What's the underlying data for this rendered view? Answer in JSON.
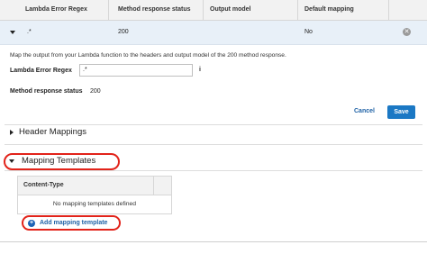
{
  "table_header": {
    "columns": [
      "Lambda Error Regex",
      "Method response status",
      "Output model",
      "Default mapping"
    ]
  },
  "row": {
    "regex": ".*",
    "status": "200",
    "output_model": "",
    "default_mapping": "No",
    "remove_glyph": "✕"
  },
  "details": {
    "description": "Map the output from your Lambda function to the headers and output model of the 200 method response.",
    "regex_label": "Lambda Error Regex",
    "regex_value": ".*",
    "info_glyph": "i",
    "status_label": "Method response status",
    "status_value": "200"
  },
  "actions": {
    "cancel": "Cancel",
    "save": "Save"
  },
  "sections": {
    "header_mappings": "Header Mappings",
    "mapping_templates": "Mapping Templates"
  },
  "content_type_table": {
    "header": "Content-Type",
    "empty_text": "No mapping templates defined"
  },
  "add_template": {
    "glyph": "+",
    "label": "Add mapping template"
  },
  "colors": {
    "accent": "#1b78c4",
    "highlight": "#e2231a",
    "row_bg": "#e8f0f8"
  }
}
